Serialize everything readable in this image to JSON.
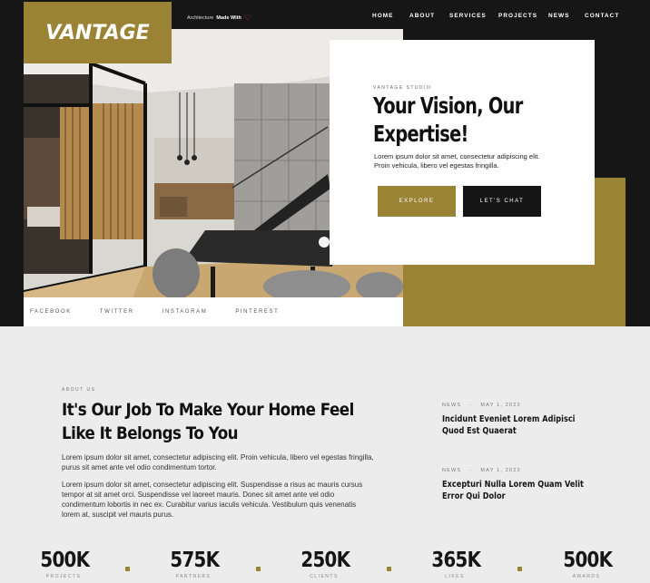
{
  "brand": {
    "logo": "VANTAGE",
    "tagline_prefix": "Architecture",
    "tagline_bold": "Made With",
    "heart": "♡"
  },
  "nav": [
    "HOME",
    "ABOUT",
    "SERVICES",
    "PROJECTS",
    "NEWS",
    "CONTACT"
  ],
  "hero": {
    "eyebrow": "VANTAGE STUDIO",
    "title": "Your Vision, Our Expertise!",
    "body": "Lorem ipsum dolor sit amet, consectetur adipiscing elit. Proin vehicula, libero vel egestas fringilla.",
    "explore": "EXPLORE",
    "chat": "LET'S CHAT"
  },
  "social": [
    "FACEBOOK",
    "TWITTER",
    "INSTAGRAM",
    "PINTEREST"
  ],
  "about": {
    "eyebrow": "ABOUT US",
    "title": "It's Our Job To Make Your Home Feel Like It Belongs To You",
    "p1": "Lorem ipsum dolor sit amet, consectetur adipiscing elit. Proin vehicula, libero vel egestas fringilla, purus sit amet ante vel odio condimentum tortor.",
    "p2": "Lorem ipsum dolor sit amet, consectetur adipiscing elit. Suspendisse a risus ac mauris cursus tempor at sit amet orci. Suspendisse vel laoreet mauris. Donec sit amet ante vel odio condimentum lobortis in nec ex. Curabitur varius iaculis vehicula. Vestibulum quis venenatis lorem at, suscipit vel mauris purus."
  },
  "news": [
    {
      "category": "NEWS",
      "sep": "-",
      "date": "MAY 1, 2022",
      "title": "Incidunt Eveniet Lorem Adipisci Quod Est Quaerat"
    },
    {
      "category": "NEWS",
      "sep": "-",
      "date": "MAY 1, 2022",
      "title": "Excepturi Nulla Lorem Quam Velit Error Qui Dolor"
    }
  ],
  "stats": [
    {
      "value": "500K",
      "label": "PROJECTS"
    },
    {
      "value": "575K",
      "label": "PARTNERS"
    },
    {
      "value": "250K",
      "label": "CLIENTS"
    },
    {
      "value": "365K",
      "label": "LIKES"
    },
    {
      "value": "500K",
      "label": "AWARDS"
    }
  ],
  "colors": {
    "accent": "#9b8336",
    "dark": "#161616",
    "background": "#ececec"
  }
}
